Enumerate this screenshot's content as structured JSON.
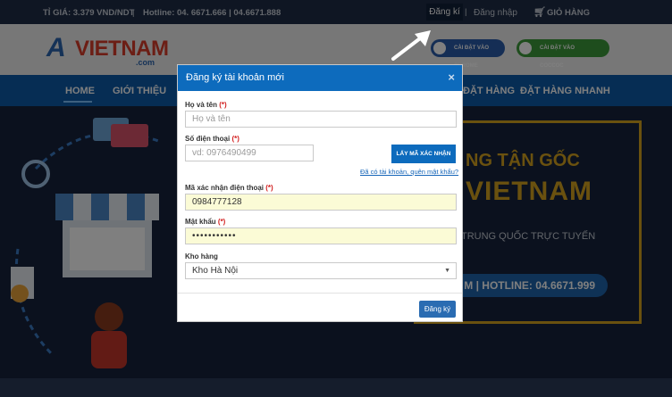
{
  "topbar": {
    "rate": "TỈ GIÁ: 3.379 VND/NDT",
    "separator": "|",
    "hotline": "Hotline: 04. 6671.666 | 04.6671.888",
    "register": "Đăng kí",
    "login": "Đăng nhập",
    "cart": "GIỎ HÀNG"
  },
  "header": {
    "logo_a": "A",
    "logo_main": "VIETNAM",
    "logo_com": ".com",
    "install_chrome": "CÀI ĐẶT VÀO CHROME",
    "install_coccoc": "CÀI ĐẶT VÀO COCCOC"
  },
  "nav": {
    "home": "HOME",
    "intro": "GIỚI THIỆU",
    "order": "ĐẶT HÀNG",
    "fast_order": "ĐẶT HÀNG NHANH"
  },
  "hero": {
    "line1": "NG TẬN GỐC",
    "line2": "VIETNAM",
    "line3": "TRUNG QUỐC TRỰC TUYẾN",
    "line4": "M | HOTLINE: 04.6671.999"
  },
  "modal": {
    "title": "Đăng ký tài khoản mới",
    "close": "×",
    "required_mark": "(*)",
    "fullname": {
      "label": "Họ và tên",
      "placeholder": "Họ và tên",
      "value": ""
    },
    "phone": {
      "label": "Số điện thoại",
      "placeholder": "vd: 0976490499",
      "value": ""
    },
    "get_code_button": "LẤY MÃ XÁC NHẬN",
    "forgot_link": "Đã có tài khoản, quên mật khẩu?",
    "verify_code": {
      "label": "Mã xác nhận điện thoại",
      "value": "0984777128"
    },
    "password": {
      "label": "Mật khẩu",
      "value": "•••••••••••"
    },
    "warehouse": {
      "label": "Kho hàng",
      "selected": "Kho Hà Nội"
    },
    "submit": "Đăng ký"
  },
  "colors": {
    "brand_blue": "#0d6bbd",
    "gold": "#d4a21f",
    "required_red": "#d21f1f",
    "autofill_yellow": "#fbfbd6"
  }
}
